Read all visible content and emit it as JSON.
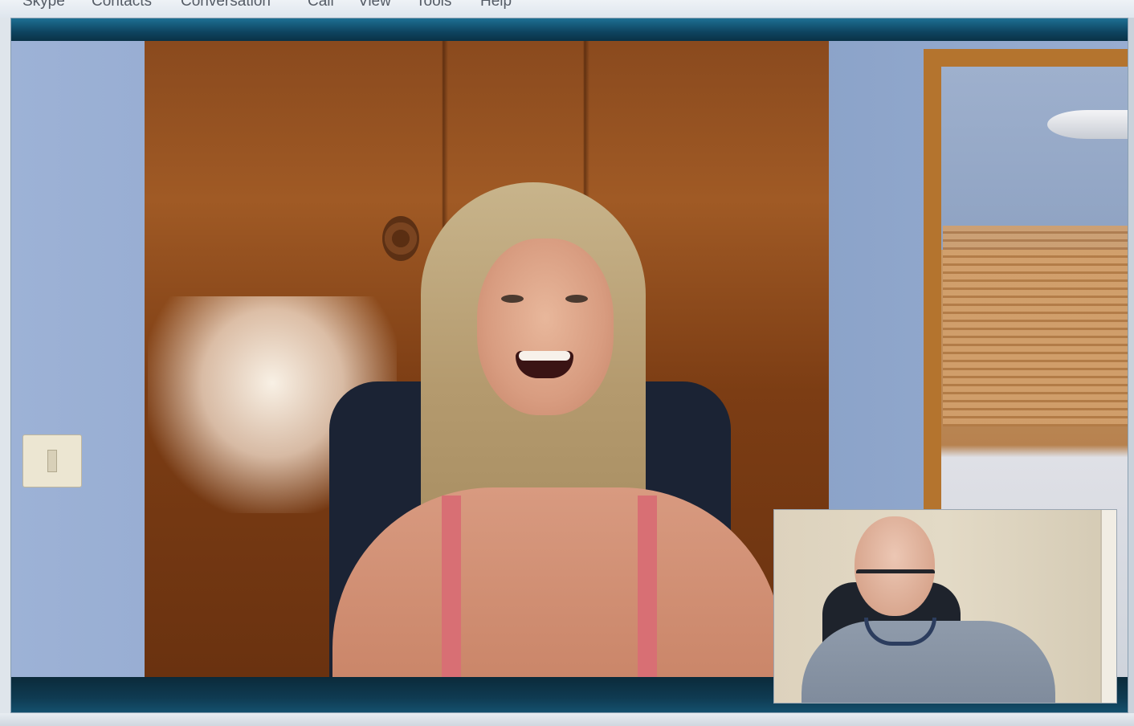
{
  "menubar": {
    "items": [
      "Skype",
      "Contacts",
      "Conversation",
      "Call",
      "View",
      "Tools",
      "Help"
    ]
  },
  "call": {
    "remote_video": {
      "description_icon": "remote-participant-video"
    },
    "self_preview": {
      "description_icon": "self-camera-preview"
    }
  },
  "colors": {
    "frame_accent": "#1d6f93",
    "frame_dark": "#0f3447"
  }
}
